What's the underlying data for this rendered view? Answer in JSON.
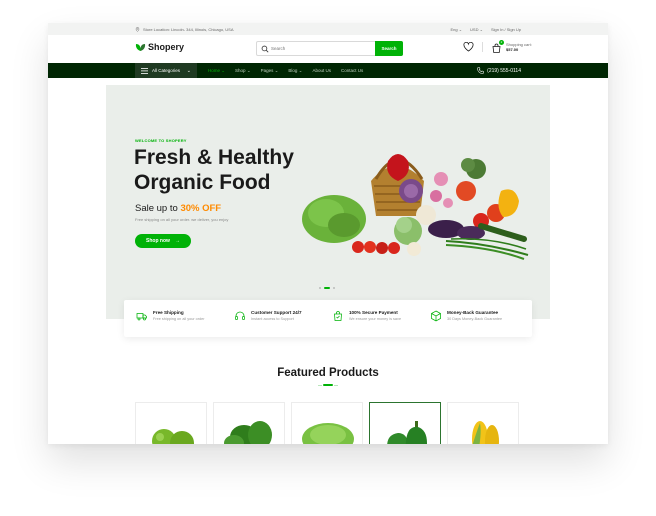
{
  "topbar": {
    "address": "Store Location: Lincoln- 344, Illinois, Chicago, USA",
    "language": "Eng",
    "currency": "USD",
    "auth": "Sign In / Sign Up"
  },
  "header": {
    "logo_text": "Shopery",
    "search_placeholder": "Search",
    "search_button": "Search",
    "cart_label": "Shopping cart:",
    "cart_total": "$57.00",
    "cart_count": "2"
  },
  "nav": {
    "all_categories": "All Categories",
    "links": [
      "Home",
      "Shop",
      "Pages",
      "Blog",
      "About Us",
      "Contact Us"
    ],
    "phone": "(219) 555-0114"
  },
  "hero": {
    "welcome": "WELCOME TO SHOPERY",
    "title": "Fresh & Healthy Organic Food",
    "sale_prefix": "Sale up to",
    "sale_value": "30% OFF",
    "subtitle": "Free shipping on all your order. we deliver, you enjoy",
    "cta": "Shop now"
  },
  "features": [
    {
      "title": "Free Shipping",
      "subtitle": "Free shipping on all your order",
      "icon": "truck-icon"
    },
    {
      "title": "Customer Support 24/7",
      "subtitle": "Instant access to Support",
      "icon": "headphones-icon"
    },
    {
      "title": "100% Secure Payment",
      "subtitle": "We ensure your money is save",
      "icon": "shopping-bag-icon"
    },
    {
      "title": "Money-Back Guarantee",
      "subtitle": "30 Days Money-Back Guarantee",
      "icon": "package-icon"
    }
  ],
  "featured": {
    "title": "Featured Products",
    "products": [
      "green-apple",
      "spinach",
      "lettuce",
      "green-capsicum",
      "corn"
    ]
  },
  "colors": {
    "accent": "#00b207",
    "nav_bg": "#002603",
    "orange": "#ff8a00",
    "hero_bg": "#eaeeea"
  }
}
